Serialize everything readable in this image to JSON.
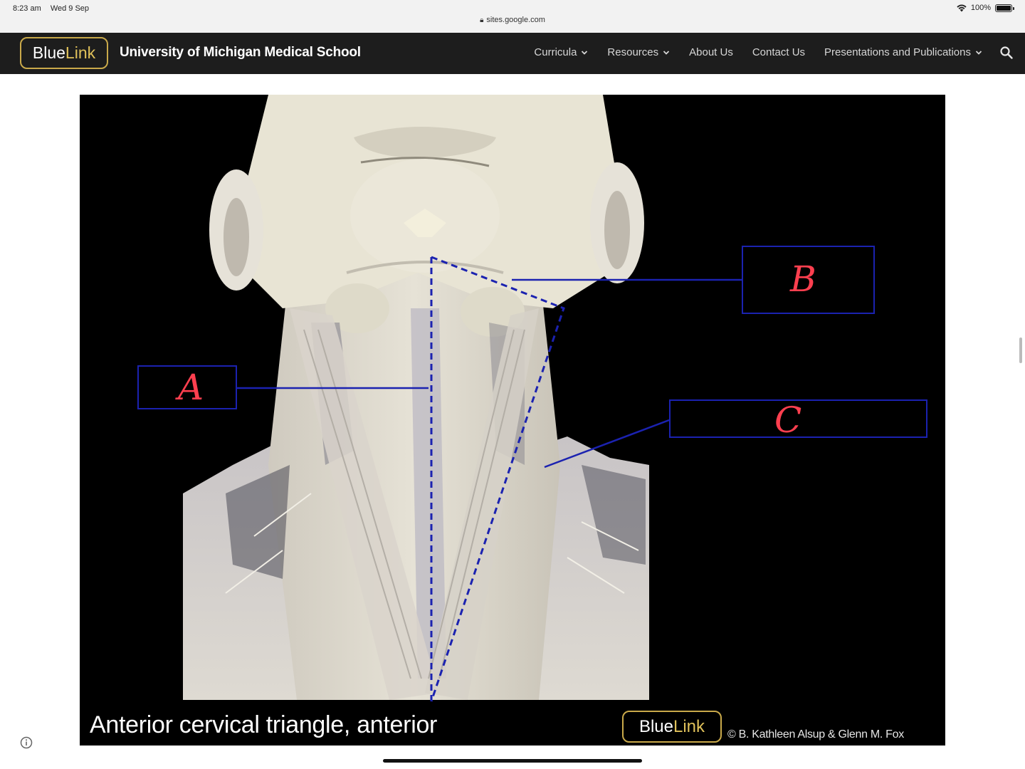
{
  "status_bar": {
    "time": "8:23 am",
    "date": "Wed 9 Sep",
    "url": "sites.google.com",
    "battery": "100%"
  },
  "site": {
    "logo_blue": "Blue",
    "logo_link": "Link",
    "title": "University of Michigan Medical School",
    "nav": [
      {
        "label": "Curricula",
        "has_dropdown": true
      },
      {
        "label": "Resources",
        "has_dropdown": true
      },
      {
        "label": "About Us",
        "has_dropdown": false
      },
      {
        "label": "Contact Us",
        "has_dropdown": false
      },
      {
        "label": "Presentations and Publications",
        "has_dropdown": true
      }
    ]
  },
  "slide": {
    "caption": "Anterior cervical triangle, anterior",
    "logo_blue": "Blue",
    "logo_link": "Link",
    "credit": "© B. Kathleen Alsup & Glenn M. Fox",
    "labels": {
      "a": "A",
      "b": "B",
      "c": "C"
    }
  },
  "colors": {
    "nav_bg": "#1d1d1d",
    "logo_gold": "#c9a94a",
    "annotation_blue": "#1b22b0",
    "handwriting_red": "#ff3f4f"
  }
}
